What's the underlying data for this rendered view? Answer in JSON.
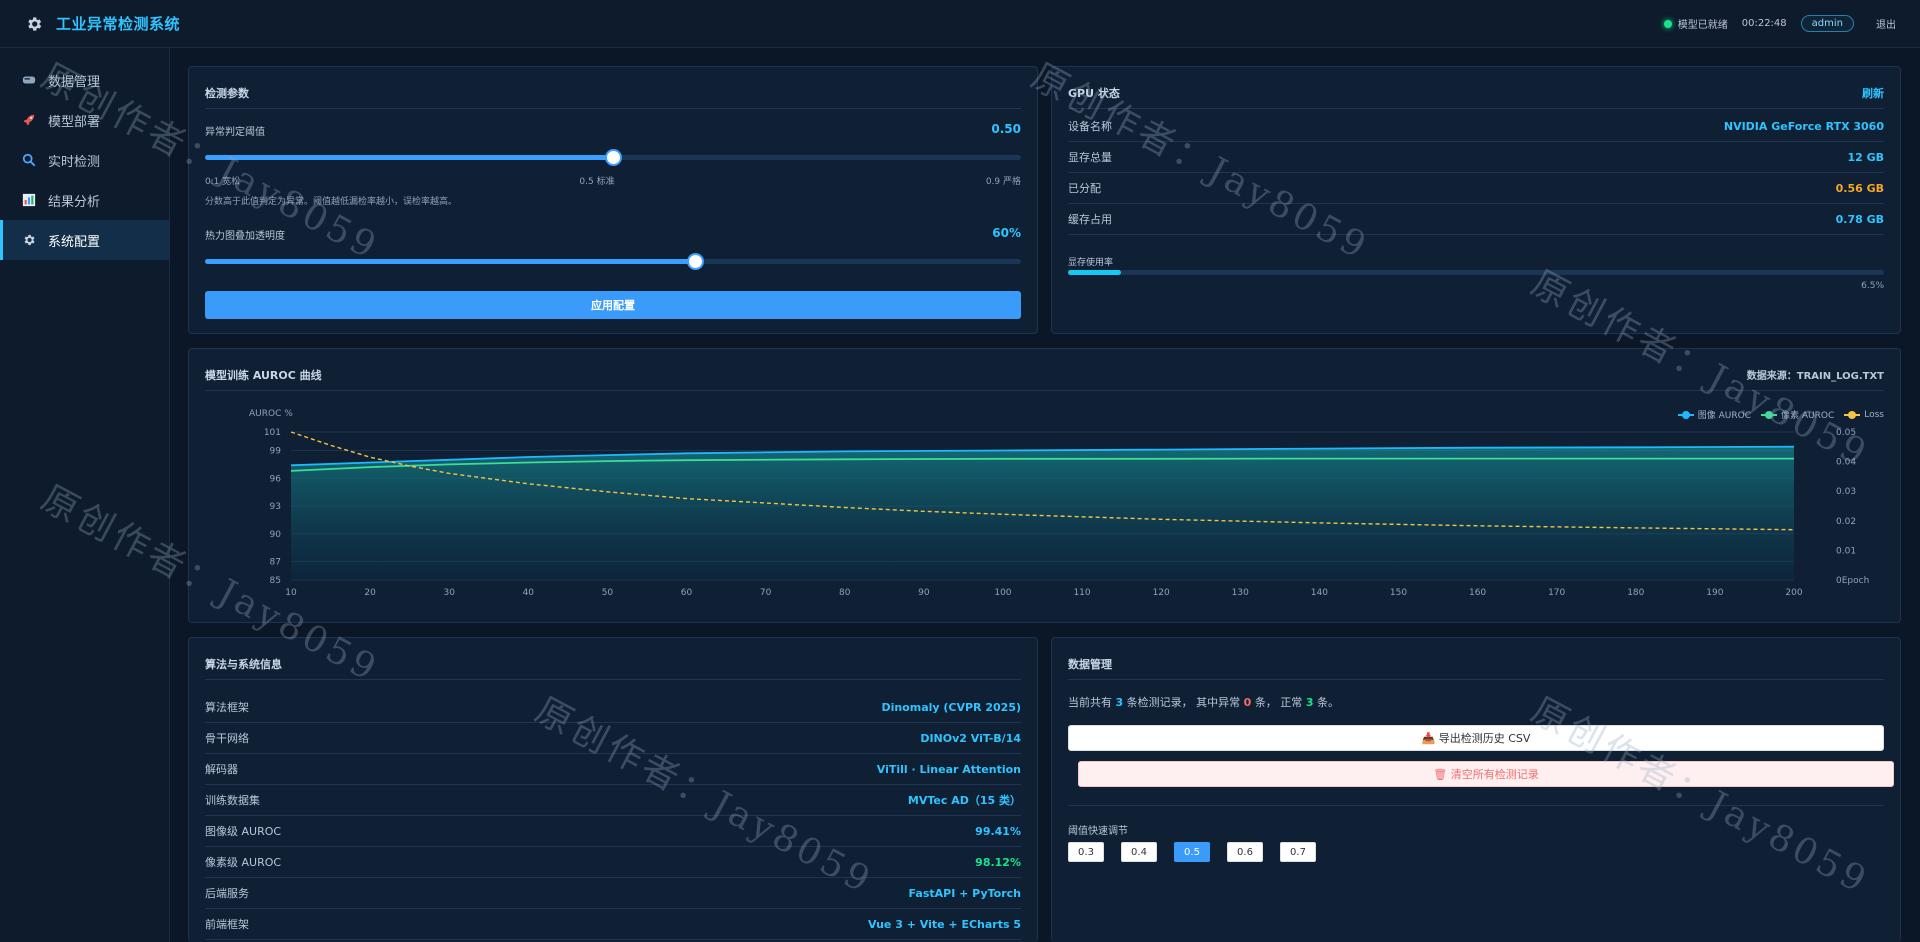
{
  "header": {
    "title": "工业异常检测系统",
    "status_text": "模型已就绪",
    "time": "00:22:48",
    "user": "admin",
    "logout": "退出"
  },
  "sidebar": {
    "items": [
      {
        "label": "数据管理",
        "icon": "database-icon"
      },
      {
        "label": "模型部署",
        "icon": "rocket-icon"
      },
      {
        "label": "实时检测",
        "icon": "magnifier-icon"
      },
      {
        "label": "结果分析",
        "icon": "bar-chart-icon"
      },
      {
        "label": "系统配置",
        "icon": "gear-icon",
        "active": true
      }
    ]
  },
  "detection": {
    "title": "检测参数",
    "threshold_label": "异常判定阈值",
    "threshold_value": "0.50",
    "threshold_fraction": 0.5,
    "ticks": [
      "0.1 宽松",
      "0.5 标准",
      "0.9 严格"
    ],
    "hint": "分数高于此值判定为异常。阈值越低漏检率越小，误检率越高。",
    "opacity_label": "热力图叠加透明度",
    "opacity_value": "60%",
    "opacity_fraction": 0.6,
    "apply_label": "应用配置"
  },
  "gpu": {
    "title": "GPU 状态",
    "refresh": "刷新",
    "rows": [
      {
        "key": "设备名称",
        "value": "NVIDIA GeForce RTX 3060",
        "style": ""
      },
      {
        "key": "显存总量",
        "value": "12 GB",
        "style": ""
      },
      {
        "key": "已分配",
        "value": "0.56 GB",
        "style": "orange"
      },
      {
        "key": "缓存占用",
        "value": "0.78 GB",
        "style": ""
      }
    ],
    "usage_label": "显存使用率",
    "usage_text": "6.5%",
    "usage_fraction": 0.065
  },
  "chart": {
    "title": "模型训练 AUROC 曲线",
    "source": "数据来源：TRAIN_LOG.TXT"
  },
  "chart_data": {
    "type": "line",
    "ylabel": "AUROC %",
    "y_ticks": [
      "101",
      "99",
      "96",
      "93",
      "90",
      "87",
      "85"
    ],
    "y_tick_values": [
      101,
      99,
      96,
      93,
      90,
      87,
      85
    ],
    "ylim": [
      85,
      101
    ],
    "y2_ticks": [
      "0.05",
      "0.04",
      "0.03",
      "0.02",
      "0.01",
      "0"
    ],
    "y2lim": [
      0,
      0.05
    ],
    "x_unit": "Epoch",
    "x_ticks": [
      10,
      20,
      30,
      40,
      50,
      60,
      70,
      80,
      90,
      100,
      110,
      120,
      130,
      140,
      150,
      160,
      170,
      180,
      190,
      200
    ],
    "xlim": [
      10,
      200
    ],
    "legend_position": "top-right",
    "series": [
      {
        "name": "图像 AUROC",
        "color": "#1fb8ff",
        "axis": "left",
        "x": [
          10,
          20,
          30,
          40,
          50,
          60,
          80,
          100,
          120,
          140,
          160,
          180,
          200
        ],
        "values": [
          97.4,
          97.7,
          98.0,
          98.3,
          98.5,
          98.7,
          98.9,
          99.0,
          99.1,
          99.2,
          99.3,
          99.35,
          99.41
        ]
      },
      {
        "name": "像素 AUROC",
        "color": "#3ddc97",
        "axis": "left",
        "x": [
          10,
          20,
          30,
          40,
          50,
          60,
          80,
          100,
          120,
          140,
          160,
          180,
          200
        ],
        "values": [
          96.8,
          97.2,
          97.5,
          97.7,
          97.85,
          97.95,
          98.05,
          98.1,
          98.1,
          98.12,
          98.12,
          98.12,
          98.12
        ]
      },
      {
        "name": "Loss",
        "color": "#f6c343",
        "axis": "right",
        "dashed": true,
        "x": [
          10,
          15,
          20,
          25,
          30,
          40,
          50,
          60,
          70,
          80,
          90,
          100,
          120,
          140,
          160,
          180,
          200
        ],
        "values": [
          0.05,
          0.0455,
          0.0415,
          0.0385,
          0.036,
          0.0325,
          0.0298,
          0.0275,
          0.026,
          0.0245,
          0.0232,
          0.0222,
          0.0205,
          0.0193,
          0.0183,
          0.0176,
          0.017
        ]
      }
    ]
  },
  "algo": {
    "title": "算法与系统信息",
    "rows": [
      {
        "key": "算法框架",
        "value": "Dinomaly (CVPR 2025)",
        "style": ""
      },
      {
        "key": "骨干网络",
        "value": "DINOv2 ViT-B/14",
        "style": ""
      },
      {
        "key": "解码器",
        "value": "ViTill · Linear Attention",
        "style": ""
      },
      {
        "key": "训练数据集",
        "value": "MVTec AD（15 类）",
        "style": ""
      },
      {
        "key": "图像级 AUROC",
        "value": "99.41%",
        "style": ""
      },
      {
        "key": "像素级 AUROC",
        "value": "98.12%",
        "style": "green"
      },
      {
        "key": "后端服务",
        "value": "FastAPI + PyTorch",
        "style": ""
      },
      {
        "key": "前端框架",
        "value": "Vue 3 + Vite + ECharts 5",
        "style": ""
      }
    ]
  },
  "data_mgmt": {
    "title": "数据管理",
    "s1": "当前共有",
    "total": "3",
    "s2": "条检测记录，",
    "s3": "其中异常",
    "abnormal": "0",
    "s4": "条，",
    "s5": "正常",
    "normal": "3",
    "s6": "条。",
    "export_label": "📥 导出检测历史 CSV",
    "clear_label": "🗑 清空所有检测记录",
    "quick_label": "阈值快速调节",
    "quick_options": [
      "0.3",
      "0.4",
      "0.5",
      "0.6",
      "0.7"
    ],
    "quick_active": "0.5"
  },
  "watermark": {
    "text": "原创作者：Jay8059"
  },
  "colors": {
    "accent": "#2fc4ff",
    "primary_button": "#3a9bfa",
    "panel_bg": "#0f2034",
    "page_bg": "#0b1626"
  }
}
